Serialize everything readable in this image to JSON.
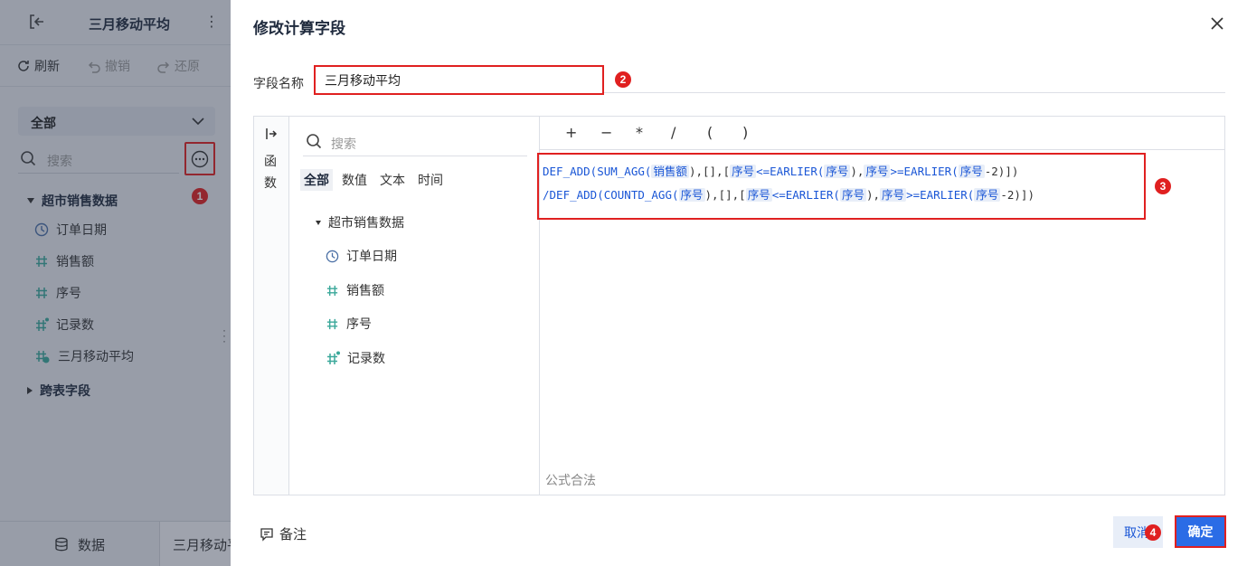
{
  "left_panel": {
    "title": "三月移动平均",
    "toolbar": {
      "refresh": "刷新",
      "undo": "撤销",
      "redo": "还原"
    },
    "scope_select": "全部",
    "search_placeholder": "搜索",
    "tree": {
      "group": "超市销售数据",
      "fields": [
        {
          "name": "订单日期",
          "icon": "clock-icon"
        },
        {
          "name": "销售额",
          "icon": "hash-icon"
        },
        {
          "name": "序号",
          "icon": "hash-icon"
        },
        {
          "name": "记录数",
          "icon": "hash-star-icon"
        },
        {
          "name": "三月移动平均",
          "icon": "hash-calc-icon"
        }
      ],
      "cross_group": "跨表字段"
    },
    "bottom_tabs": {
      "data": "数据",
      "sheet": "三月移动平均"
    }
  },
  "dialog": {
    "title": "修改计算字段",
    "field_label": "字段名称",
    "field_value": "三月移动平均",
    "function_tab": "函数",
    "search_placeholder": "搜索",
    "type_tabs": [
      "全部",
      "数值",
      "文本",
      "时间"
    ],
    "tree": {
      "group": "超市销售数据",
      "fields": [
        {
          "name": "订单日期",
          "icon": "clock-icon"
        },
        {
          "name": "销售额",
          "icon": "hash-icon"
        },
        {
          "name": "序号",
          "icon": "hash-icon"
        },
        {
          "name": "记录数",
          "icon": "hash-star-icon"
        }
      ]
    },
    "operators": [
      "+",
      "−",
      "*",
      "/",
      "(",
      ")"
    ],
    "formula": {
      "line1": [
        {
          "t": "DEF_ADD(SUM_AGG(",
          "k": "f"
        },
        {
          "t": "销售额",
          "k": "fld"
        },
        {
          "t": "),[],[",
          "k": "p"
        },
        {
          "t": "序号",
          "k": "fld"
        },
        {
          "t": "<=EARLIER(",
          "k": "f"
        },
        {
          "t": "序号",
          "k": "fld"
        },
        {
          "t": "),",
          "k": "p"
        },
        {
          "t": "序号",
          "k": "fld"
        },
        {
          "t": ">=EARLIER(",
          "k": "f"
        },
        {
          "t": "序号",
          "k": "fld"
        },
        {
          "t": "-2)])",
          "k": "p"
        }
      ],
      "line2": [
        {
          "t": "/DEF_ADD(COUNTD_AGG(",
          "k": "f"
        },
        {
          "t": "序号",
          "k": "fld"
        },
        {
          "t": "),[],[",
          "k": "p"
        },
        {
          "t": "序号",
          "k": "fld"
        },
        {
          "t": "<=EARLIER(",
          "k": "f"
        },
        {
          "t": "序号",
          "k": "fld"
        },
        {
          "t": "),",
          "k": "p"
        },
        {
          "t": "序号",
          "k": "fld"
        },
        {
          "t": ">=EARLIER(",
          "k": "f"
        },
        {
          "t": "序号",
          "k": "fld"
        },
        {
          "t": "-2)])",
          "k": "p"
        }
      ]
    },
    "status": "公式合法",
    "note": "备注",
    "cancel": "取消",
    "ok": "确定"
  },
  "annotations": [
    "1",
    "2",
    "3",
    "4"
  ],
  "colors": {
    "accent": "#2b6ce6",
    "highlight": "#e02020",
    "field_icon": "#3aa89a"
  }
}
